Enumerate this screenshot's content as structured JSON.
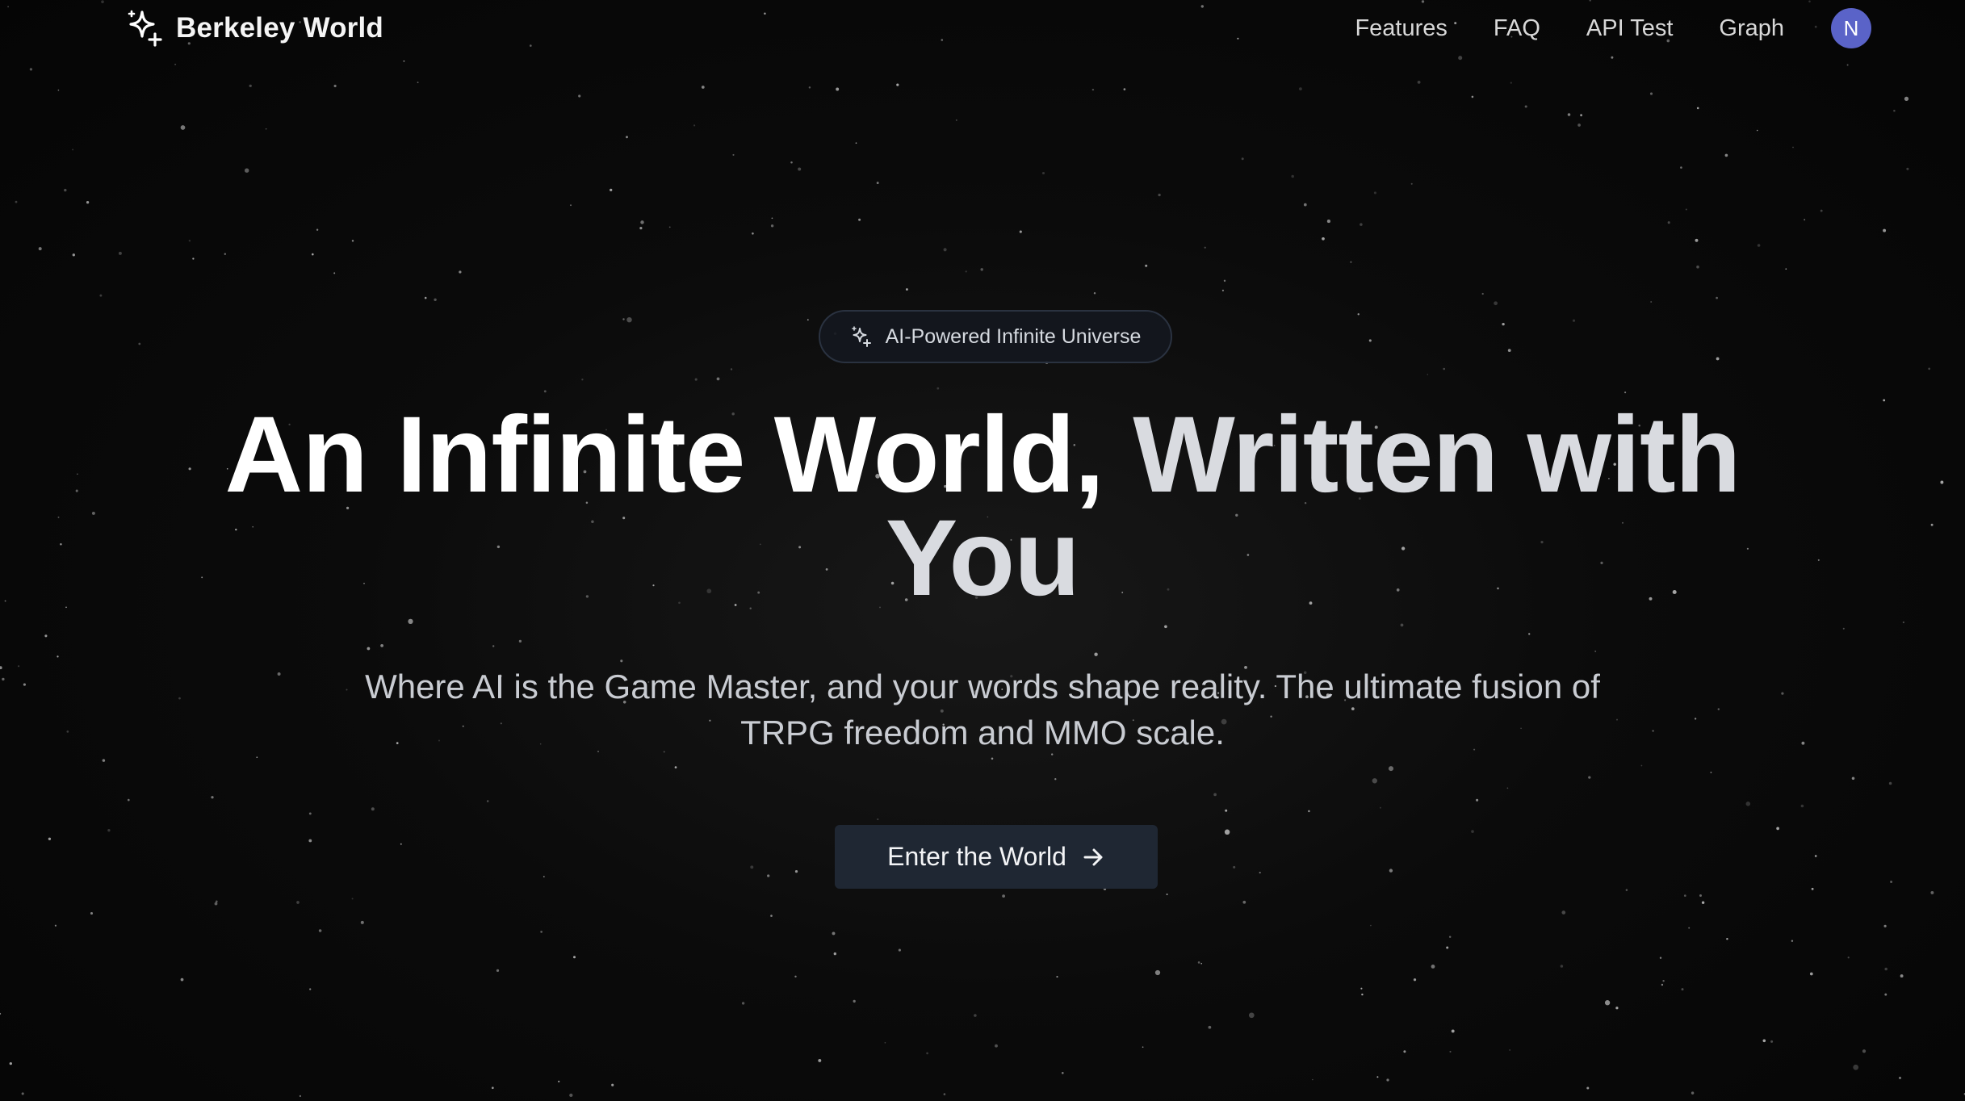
{
  "header": {
    "brand": {
      "name": "Berkeley World",
      "icon": "sparkles-icon"
    },
    "nav": [
      {
        "label": "Features"
      },
      {
        "label": "FAQ"
      },
      {
        "label": "API Test"
      },
      {
        "label": "Graph"
      }
    ],
    "avatar": {
      "initial": "N",
      "color": "#5a63c8"
    }
  },
  "hero": {
    "badge": {
      "icon": "sparkles-icon",
      "label": "AI-Powered Infinite Universe"
    },
    "headline": {
      "part1": "An Infinite World,",
      "part2": "Written with",
      "part3": "You"
    },
    "subtitle": "Where AI is the Game Master, and your words shape reality. The ultimate fusion of TRPG freedom and MMO scale.",
    "cta": {
      "label": "Enter the World",
      "icon": "arrow-right-icon"
    }
  },
  "colors": {
    "background": "#000000",
    "button": "#1f2733",
    "avatar": "#5a63c8",
    "headline_accent": "#d9dbe0"
  }
}
